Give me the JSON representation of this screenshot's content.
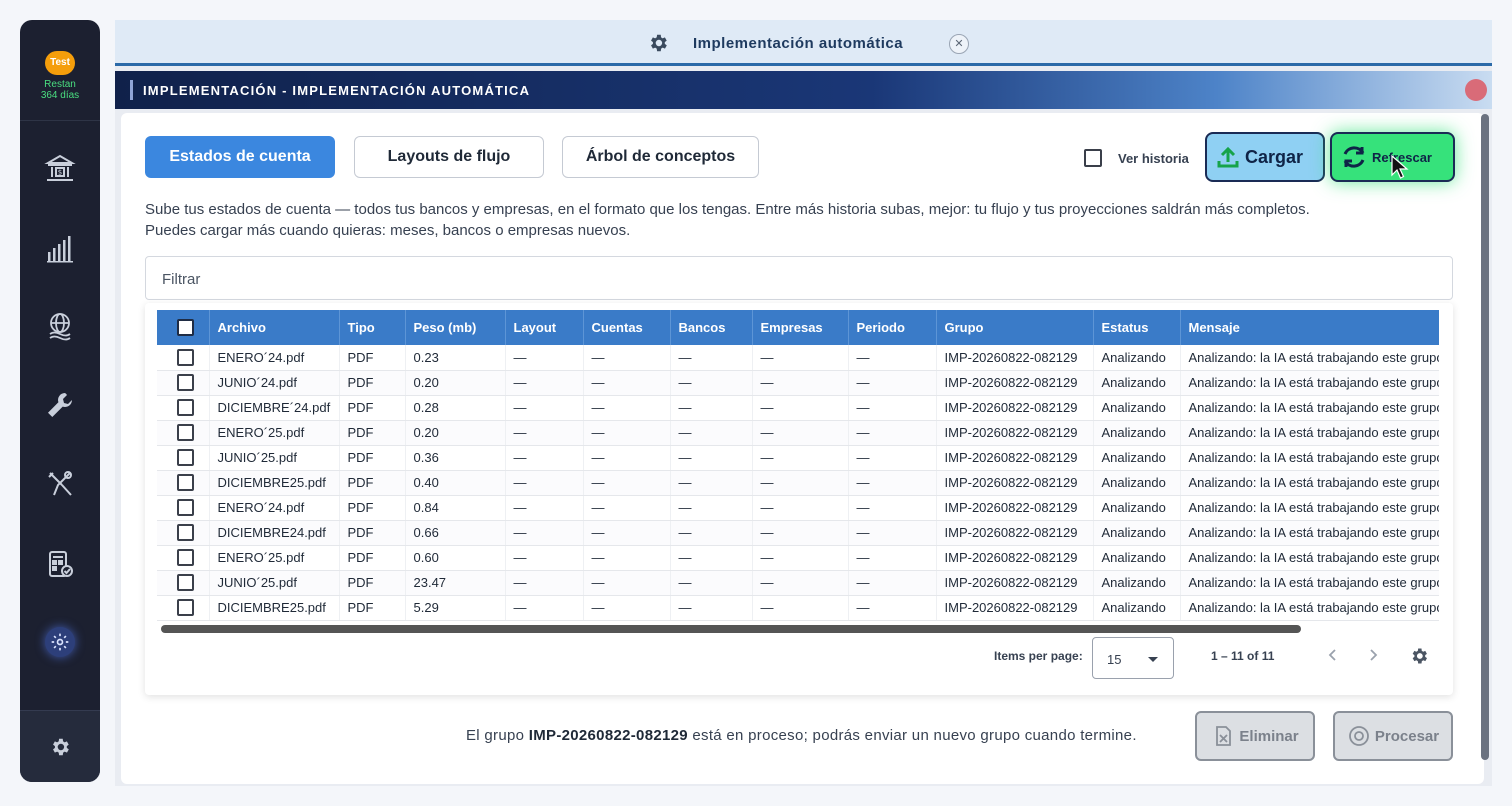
{
  "sidebar": {
    "badge": "Test",
    "trial_line1": "Restan",
    "trial_line2": "364 días",
    "items": [
      {
        "name": "bank"
      },
      {
        "name": "bar-chart"
      },
      {
        "name": "money-globe"
      },
      {
        "name": "wrench"
      },
      {
        "name": "tools"
      },
      {
        "name": "calculator-check"
      },
      {
        "name": "gear",
        "active": true
      }
    ]
  },
  "tab": {
    "title": "Implementación automática",
    "close_label": "✕"
  },
  "header": {
    "title": "IMPLEMENTACIÓN - IMPLEMENTACIÓN AUTOMÁTICA"
  },
  "toolbar": {
    "tabs": [
      {
        "label": "Estados de cuenta",
        "active": true
      },
      {
        "label": "Layouts de flujo",
        "active": false
      },
      {
        "label": "Árbol de conceptos",
        "active": false
      }
    ],
    "ver_historia": "Ver historia",
    "cargar": "Cargar",
    "refrescar": "Refrescar"
  },
  "description": {
    "line1": "Sube tus estados de cuenta — todos tus bancos y empresas, en el formato que los tengas. Entre más historia subas, mejor: tu flujo y tus proyecciones saldrán más completos.",
    "line2": "Puedes cargar más cuando quieras: meses, bancos o empresas nuevos."
  },
  "filter": {
    "placeholder": "Filtrar"
  },
  "table": {
    "columns": [
      "Archivo",
      "Tipo",
      "Peso (mb)",
      "Layout",
      "Cuentas",
      "Bancos",
      "Empresas",
      "Periodo",
      "Grupo",
      "Estatus",
      "Mensaje"
    ],
    "rows": [
      [
        "ENERO´24.pdf",
        "PDF",
        "0.23",
        "—",
        "—",
        "—",
        "—",
        "—",
        "IMP-20260822-082129",
        "Analizando",
        "Analizando: la IA está trabajando este grupo"
      ],
      [
        "JUNIO´24.pdf",
        "PDF",
        "0.20",
        "—",
        "—",
        "—",
        "—",
        "—",
        "IMP-20260822-082129",
        "Analizando",
        "Analizando: la IA está trabajando este grupo"
      ],
      [
        "DICIEMBRE´24.pdf",
        "PDF",
        "0.28",
        "—",
        "—",
        "—",
        "—",
        "—",
        "IMP-20260822-082129",
        "Analizando",
        "Analizando: la IA está trabajando este grupo"
      ],
      [
        "ENERO´25.pdf",
        "PDF",
        "0.20",
        "—",
        "—",
        "—",
        "—",
        "—",
        "IMP-20260822-082129",
        "Analizando",
        "Analizando: la IA está trabajando este grupo"
      ],
      [
        "JUNIO´25.pdf",
        "PDF",
        "0.36",
        "—",
        "—",
        "—",
        "—",
        "—",
        "IMP-20260822-082129",
        "Analizando",
        "Analizando: la IA está trabajando este grupo"
      ],
      [
        "DICIEMBRE25.pdf",
        "PDF",
        "0.40",
        "—",
        "—",
        "—",
        "—",
        "—",
        "IMP-20260822-082129",
        "Analizando",
        "Analizando: la IA está trabajando este grupo"
      ],
      [
        "ENERO´24.pdf",
        "PDF",
        "0.84",
        "—",
        "—",
        "—",
        "—",
        "—",
        "IMP-20260822-082129",
        "Analizando",
        "Analizando: la IA está trabajando este grupo"
      ],
      [
        "DICIEMBRE24.pdf",
        "PDF",
        "0.66",
        "—",
        "—",
        "—",
        "—",
        "—",
        "IMP-20260822-082129",
        "Analizando",
        "Analizando: la IA está trabajando este grupo"
      ],
      [
        "ENERO´25.pdf",
        "PDF",
        "0.60",
        "—",
        "—",
        "—",
        "—",
        "—",
        "IMP-20260822-082129",
        "Analizando",
        "Analizando: la IA está trabajando este grupo"
      ],
      [
        "JUNIO´25.pdf",
        "PDF",
        "23.47",
        "—",
        "—",
        "—",
        "—",
        "—",
        "IMP-20260822-082129",
        "Analizando",
        "Analizando: la IA está trabajando este grupo"
      ],
      [
        "DICIEMBRE25.pdf",
        "PDF",
        "5.29",
        "—",
        "—",
        "—",
        "—",
        "—",
        "IMP-20260822-082129",
        "Analizando",
        "Analizando: la IA está trabajando este grupo"
      ]
    ]
  },
  "pager": {
    "items_label": "Items per page:",
    "page_size": "15",
    "range": "1 – 11 of 11"
  },
  "footer": {
    "prefix": "El grupo",
    "group": "IMP-20260822-082129",
    "suffix": "está en proceso; podrás enviar un nuevo grupo cuando termine.",
    "eliminar": "Eliminar",
    "procesar": "Procesar"
  },
  "colors": {
    "accent": "#3b87df",
    "cargar": "#8fd0f3",
    "refrescar": "#36e27b",
    "sidebar": "#1c2030"
  }
}
